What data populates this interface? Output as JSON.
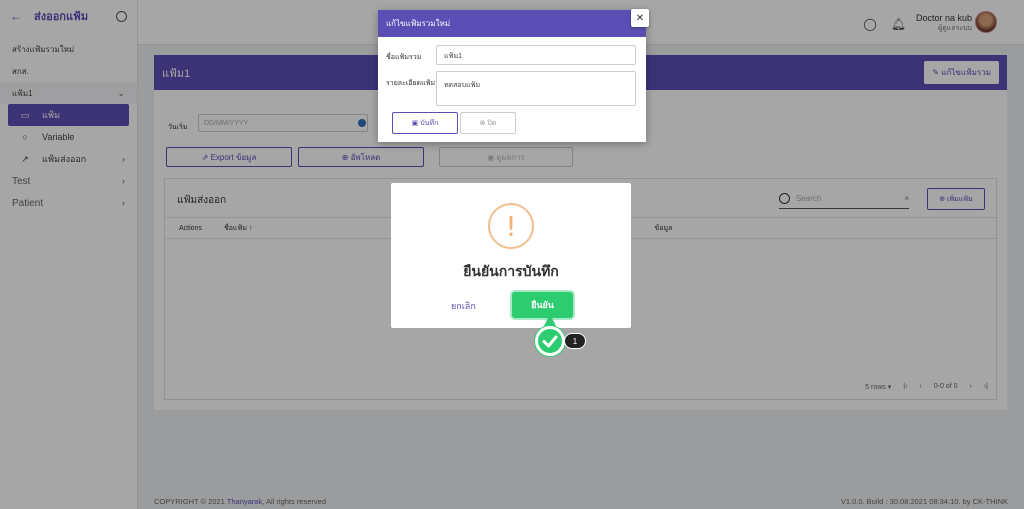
{
  "sidebar": {
    "title": "ส่งออกแฟ้ม",
    "items": [
      {
        "label": "สร้างแฟ้มรวมใหม่"
      },
      {
        "label": "สกส."
      },
      {
        "label": "แฟ้ม1"
      },
      {
        "label": "แฟ้ม"
      },
      {
        "label": "Variable"
      },
      {
        "label": "แฟ้มส่งออก"
      },
      {
        "label": "Test"
      },
      {
        "label": "Patient"
      }
    ]
  },
  "topbar": {
    "user_name": "Doctor na kub",
    "user_role": "ผู้ดูแลระบบ"
  },
  "page": {
    "banner_title": "แฟ้ม1",
    "edit_label": "แก้ไขแฟ้มรวม",
    "date_label": "วันเริ่ม",
    "date_placeholder": "DD/MM/YYYY",
    "export_label": "Export ข้อมูล",
    "upload_label": "อัพโหลด",
    "view_label": "ดูผลการ",
    "table_title": "แฟ้มส่งออก",
    "search_placeholder": "Search",
    "add_label": "เพิ่มแฟ้ม",
    "col_actions": "Actions",
    "col_name": "ชื่อแฟ้ม",
    "col_info": "ข้อมูล",
    "rows_label": "5 rows",
    "page_info": "0-0 of 0"
  },
  "edit_dialog": {
    "title": "แก้ไขแฟ้มรวมใหม่",
    "name_label": "ชื่อแฟ้มรวม",
    "name_value": "แฟ้ม1",
    "desc_label": "รายละเอียดแฟ้ม",
    "desc_value": "ทดสอบแฟ้ม",
    "save_label": "บันทึก",
    "close_label": "ปิด"
  },
  "confirm_dialog": {
    "title": "ยืนยันการบันทึก",
    "cancel_label": "ยกเลิก",
    "confirm_label": "ยืนยัน"
  },
  "step_badge": "1",
  "footer": {
    "copyright": "COPYRIGHT © 2021 ",
    "brand": "Thanyarak",
    "rights": ", All rights reserved",
    "version": "V1.0.0. Build : 30.08.2021 08:34:10. by CK-THINK"
  },
  "colors": {
    "accent": "#5b4fb5",
    "success": "#2ecc71",
    "warning": "#f0c090"
  }
}
